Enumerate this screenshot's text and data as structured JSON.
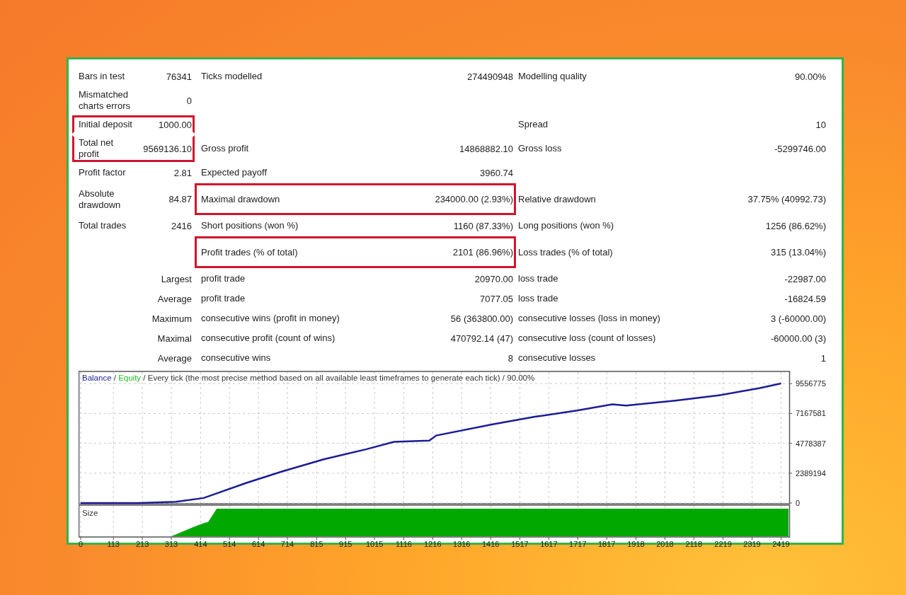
{
  "report": {
    "rows": [
      {
        "left": {
          "label": "Bars in test",
          "value": "76341",
          "highlighted": false
        },
        "middle": {
          "label": "Ticks modelled",
          "value": "274490948",
          "highlighted": false
        },
        "right": {
          "label": "Modelling quality",
          "value": "90.00%",
          "highlighted": false
        }
      },
      {
        "left": {
          "label": "Mismatched charts errors",
          "value": "0",
          "highlighted": false
        }
      },
      {
        "left": {
          "label": "Initial deposit",
          "value": "1000.00",
          "highlighted": true
        },
        "right": {
          "label": "Spread",
          "value": "10",
          "highlighted": false
        }
      },
      {
        "left": {
          "label": "Total net profit",
          "value": "9569136.10",
          "highlighted": true
        },
        "middle": {
          "label": "Gross profit",
          "value": "14868882.10",
          "highlighted": false
        },
        "right": {
          "label": "Gross loss",
          "value": "-5299746.00",
          "highlighted": false
        }
      },
      {
        "left": {
          "label": "Profit factor",
          "value": "2.81",
          "highlighted": false
        },
        "middle": {
          "label": "Expected payoff",
          "value": "3960.74",
          "highlighted": false
        }
      },
      {
        "left": {
          "label": "Absolute drawdown",
          "value": "84.87",
          "highlighted": false
        },
        "middle": {
          "label": "Maximal drawdown",
          "value": "234000.00 (2.93%)",
          "highlighted": true
        },
        "right": {
          "label": "Relative drawdown",
          "value": "37.75% (40992.73)",
          "highlighted": false
        }
      },
      {
        "left": {
          "label": "Total trades",
          "value": "2416",
          "highlighted": false
        },
        "middle": {
          "label": "Short positions (won %)",
          "value": "1160 (87.33%)",
          "highlighted": false
        },
        "right": {
          "label": "Long positions (won %)",
          "value": "1256 (86.62%)",
          "highlighted": false
        }
      },
      {
        "middle": {
          "label": "Profit trades (% of total)",
          "value": "2101 (86.96%)",
          "highlighted": true
        },
        "right": {
          "label": "Loss trades (% of total)",
          "value": "315 (13.04%)",
          "highlighted": false
        }
      },
      {
        "prefix": "Largest",
        "middle": {
          "label": "profit trade",
          "value": "20970.00",
          "highlighted": false
        },
        "right": {
          "label": "loss trade",
          "value": "-22987.00",
          "highlighted": false
        }
      },
      {
        "prefix": "Average",
        "middle": {
          "label": "profit trade",
          "value": "7077.05",
          "highlighted": false
        },
        "right": {
          "label": "loss trade",
          "value": "-16824.59",
          "highlighted": false
        }
      },
      {
        "prefix": "Maximum",
        "middle": {
          "label": "consecutive wins (profit in money)",
          "value": "56 (363800.00)",
          "highlighted": false
        },
        "right": {
          "label": "consecutive losses (loss in money)",
          "value": "3 (-60000.00)",
          "highlighted": false
        }
      },
      {
        "prefix": "Maximal",
        "middle": {
          "label": "consecutive profit (count of wins)",
          "value": "470792.14 (47)",
          "highlighted": false
        },
        "right": {
          "label": "consecutive loss (count of losses)",
          "value": "-60000.00 (3)",
          "highlighted": false
        }
      },
      {
        "prefix": "Average",
        "middle": {
          "label": "consecutive wins",
          "value": "8",
          "highlighted": false
        },
        "right": {
          "label": "consecutive losses",
          "value": "1",
          "highlighted": false
        }
      }
    ]
  },
  "chart": {
    "legend": {
      "separator": "/",
      "items": [
        {
          "label": "Equity",
          "color": "#22bb22"
        }
      ],
      "caption": "Every tick (the most precise method based on all available least timeframes to generate each tick) / 90.00%"
    },
    "size_label": "Size",
    "chart_data": {
      "type": "line",
      "grid": true,
      "xlim": [
        0,
        2440
      ],
      "ylim": [
        0,
        10474000
      ],
      "xticks": [
        0,
        113,
        213,
        313,
        414,
        514,
        614,
        714,
        815,
        915,
        1015,
        1116,
        1216,
        1316,
        1416,
        1517,
        1617,
        1717,
        1817,
        1918,
        2018,
        2118,
        2219,
        2319,
        2419
      ],
      "yticks": [
        0,
        2389194,
        4778387,
        7167581,
        9556775
      ],
      "x": [
        0,
        200,
        328,
        425,
        571,
        693,
        839,
        985,
        1082,
        1204,
        1228,
        1423,
        1569,
        1714,
        1836,
        1884,
        2054,
        2200,
        2346,
        2419
      ],
      "series": [
        {
          "name": "Balance",
          "color": "#1c1c96",
          "values": [
            0,
            0,
            100000,
            400000,
            1600000,
            2500000,
            3500000,
            4300000,
            4900000,
            5000000,
            5400000,
            6300000,
            6900000,
            7400000,
            7900000,
            7800000,
            8200000,
            8600000,
            9200000,
            9570000
          ]
        }
      ]
    }
  }
}
